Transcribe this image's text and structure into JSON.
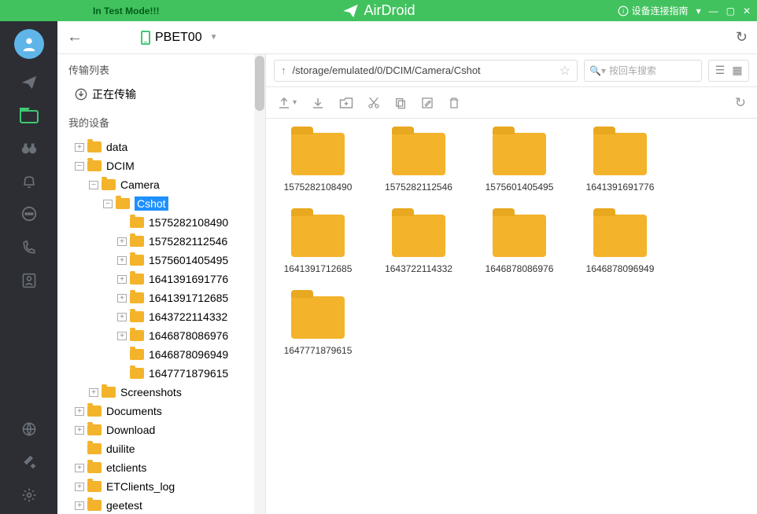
{
  "title_bar": {
    "test_mode": "In Test Mode!!!",
    "app_name": "AirDroid",
    "guide": "设备连接指南"
  },
  "device": {
    "name": "PBET00"
  },
  "tree": {
    "transfer_list_header": "传输列表",
    "transferring": "正在传输",
    "my_device": "我的设备",
    "nodes": [
      {
        "label": "data",
        "level": 0,
        "expandable": true,
        "expanded": false
      },
      {
        "label": "DCIM",
        "level": 0,
        "expandable": true,
        "expanded": true
      },
      {
        "label": "Camera",
        "level": 1,
        "expandable": true,
        "expanded": true
      },
      {
        "label": "Cshot",
        "level": 2,
        "expandable": true,
        "expanded": true,
        "selected": true
      },
      {
        "label": "1575282108490",
        "level": 3,
        "expandable": false
      },
      {
        "label": "1575282112546",
        "level": 3,
        "expandable": true,
        "expanded": false
      },
      {
        "label": "1575601405495",
        "level": 3,
        "expandable": true,
        "expanded": false
      },
      {
        "label": "1641391691776",
        "level": 3,
        "expandable": true,
        "expanded": false
      },
      {
        "label": "1641391712685",
        "level": 3,
        "expandable": true,
        "expanded": false
      },
      {
        "label": "1643722114332",
        "level": 3,
        "expandable": true,
        "expanded": false
      },
      {
        "label": "1646878086976",
        "level": 3,
        "expandable": true,
        "expanded": false
      },
      {
        "label": "1646878096949",
        "level": 3,
        "expandable": false
      },
      {
        "label": "1647771879615",
        "level": 3,
        "expandable": false
      },
      {
        "label": "Screenshots",
        "level": 1,
        "expandable": true,
        "expanded": false
      },
      {
        "label": "Documents",
        "level": 0,
        "expandable": true,
        "expanded": false
      },
      {
        "label": "Download",
        "level": 0,
        "expandable": true,
        "expanded": false
      },
      {
        "label": "duilite",
        "level": 0,
        "expandable": false
      },
      {
        "label": "etclients",
        "level": 0,
        "expandable": true,
        "expanded": false
      },
      {
        "label": "ETClients_log",
        "level": 0,
        "expandable": true,
        "expanded": false
      },
      {
        "label": "geetest",
        "level": 0,
        "expandable": true,
        "expanded": false
      }
    ]
  },
  "path": {
    "value": "/storage/emulated/0/DCIM/Camera/Cshot"
  },
  "search": {
    "placeholder": "按回车搜索"
  },
  "folders": [
    {
      "name": "1575282108490"
    },
    {
      "name": "1575282112546"
    },
    {
      "name": "1575601405495"
    },
    {
      "name": "1641391691776"
    },
    {
      "name": "1641391712685"
    },
    {
      "name": "1643722114332"
    },
    {
      "name": "1646878086976"
    },
    {
      "name": "1646878096949"
    },
    {
      "name": "1647771879615"
    }
  ]
}
